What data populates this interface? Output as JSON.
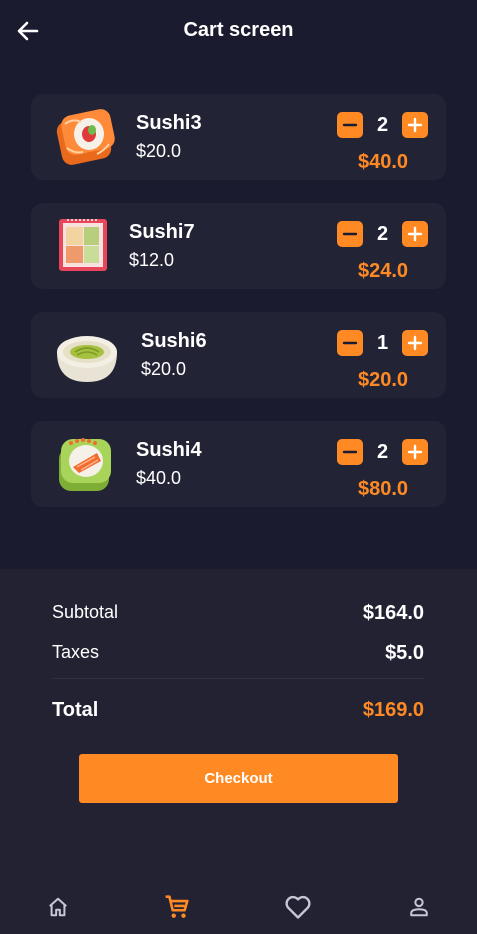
{
  "app_bar": {
    "title": "Cart screen",
    "back_icon": "arrow-left-icon"
  },
  "cart": {
    "items": [
      {
        "name": "Sushi3",
        "price": "$20.0",
        "quantity": "2",
        "line_total": "$40.0",
        "image": "sushi-roll-salmon"
      },
      {
        "name": "Sushi7",
        "price": "$12.0",
        "quantity": "2",
        "line_total": "$24.0",
        "image": "sushi-box"
      },
      {
        "name": "Sushi6",
        "price": "$20.0",
        "quantity": "1",
        "line_total": "$20.0",
        "image": "wasabi-bowl"
      },
      {
        "name": "Sushi4",
        "price": "$40.0",
        "quantity": "2",
        "line_total": "$80.0",
        "image": "sushi-roll-avocado"
      }
    ]
  },
  "summary": {
    "subtotal_label": "Subtotal",
    "subtotal_value": "$164.0",
    "taxes_label": "Taxes",
    "taxes_value": "$5.0",
    "total_label": "Total",
    "total_value": "$169.0",
    "checkout_label": "Checkout"
  },
  "bottom_nav": {
    "items": [
      {
        "icon": "home-icon",
        "active": false
      },
      {
        "icon": "cart-icon",
        "active": true
      },
      {
        "icon": "heart-icon",
        "active": false
      },
      {
        "icon": "person-icon",
        "active": false
      }
    ]
  },
  "colors": {
    "background": "#1b1b2f",
    "card": "#232336",
    "accent": "#ff8a23",
    "summary_panel": "#222233"
  }
}
